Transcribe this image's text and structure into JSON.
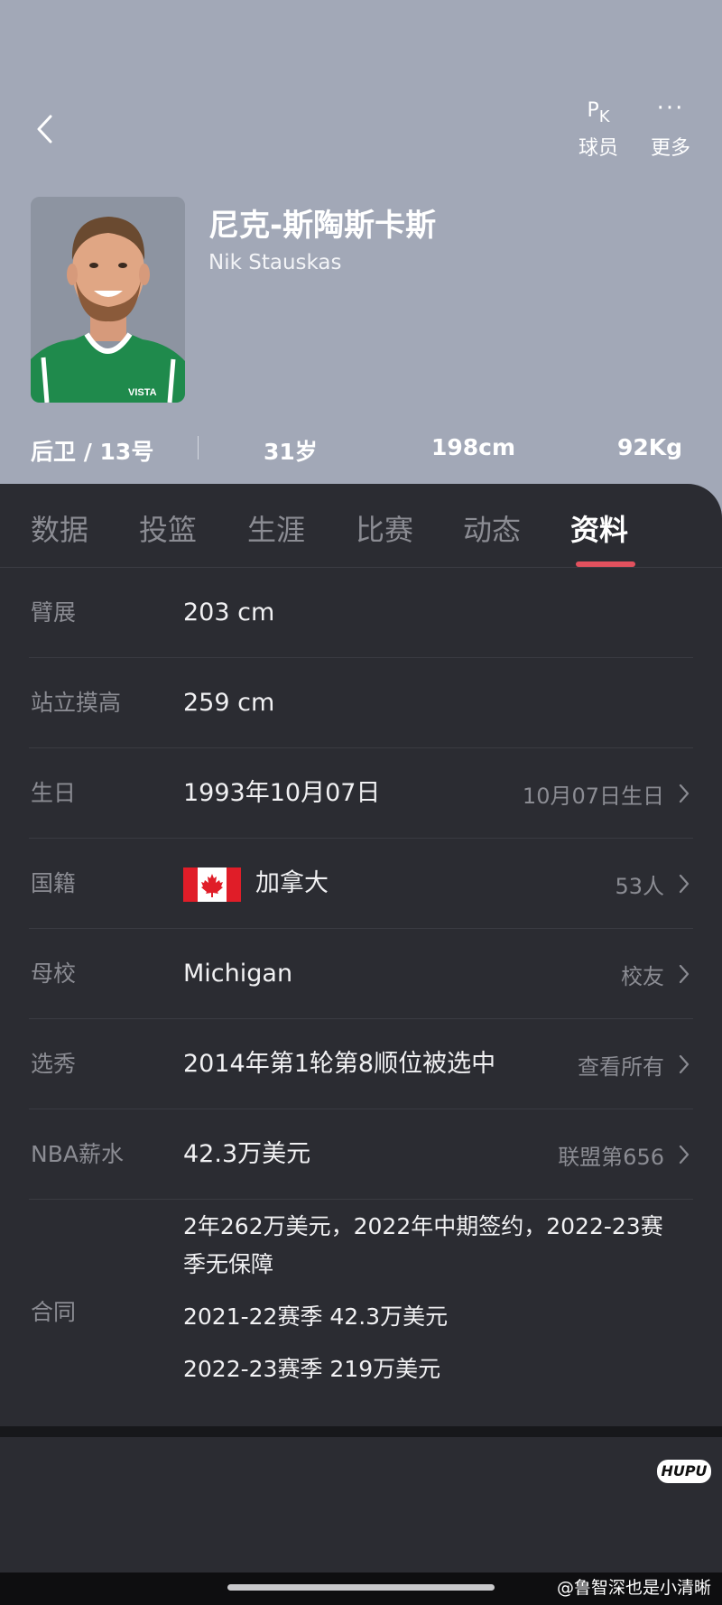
{
  "header": {
    "actions": [
      {
        "label": "球员",
        "icon": "pk-icon"
      },
      {
        "label": "更多",
        "icon": "more-icon"
      }
    ],
    "pk_icon_text": {
      "p": "P",
      "k": "K"
    },
    "player": {
      "name_cn": "尼克-斯陶斯卡斯",
      "name_en": "Nik Stauskas",
      "jersey_text": "VISTA"
    },
    "stats": {
      "position_number": "后卫 / 13号",
      "age": "31岁",
      "height": "198cm",
      "weight": "92Kg"
    },
    "background_color": "#a2a8b7"
  },
  "tabs": [
    {
      "label": "数据",
      "active": false
    },
    {
      "label": "投篮",
      "active": false
    },
    {
      "label": "生涯",
      "active": false
    },
    {
      "label": "比赛",
      "active": false
    },
    {
      "label": "动态",
      "active": false
    },
    {
      "label": "资料",
      "active": true
    }
  ],
  "accent_color": "#e2515e",
  "profile": {
    "wingspan": {
      "label": "臂展",
      "value": "203 cm"
    },
    "standing_reach": {
      "label": "站立摸高",
      "value": "259 cm"
    },
    "birthday": {
      "label": "生日",
      "value": "1993年10月07日",
      "link": "10月07日生日"
    },
    "nationality": {
      "label": "国籍",
      "value": "加拿大",
      "link": "53人",
      "flag": "canada-flag"
    },
    "college": {
      "label": "母校",
      "value": "Michigan",
      "link": "校友"
    },
    "draft": {
      "label": "选秀",
      "value": "2014年第1轮第8顺位被选中",
      "link": "查看所有"
    },
    "salary": {
      "label": "NBA薪水",
      "value": "42.3万美元",
      "link": "联盟第656"
    },
    "contract": {
      "label": "合同",
      "lines": [
        "2年262万美元，2022年中期签约，2022-23赛",
        "季无保障",
        "2021-22赛季 42.3万美元",
        "2022-23赛季 219万美元"
      ]
    }
  },
  "watermark": {
    "logo": "HUPU",
    "text": "@鲁智深也是小清晰"
  }
}
